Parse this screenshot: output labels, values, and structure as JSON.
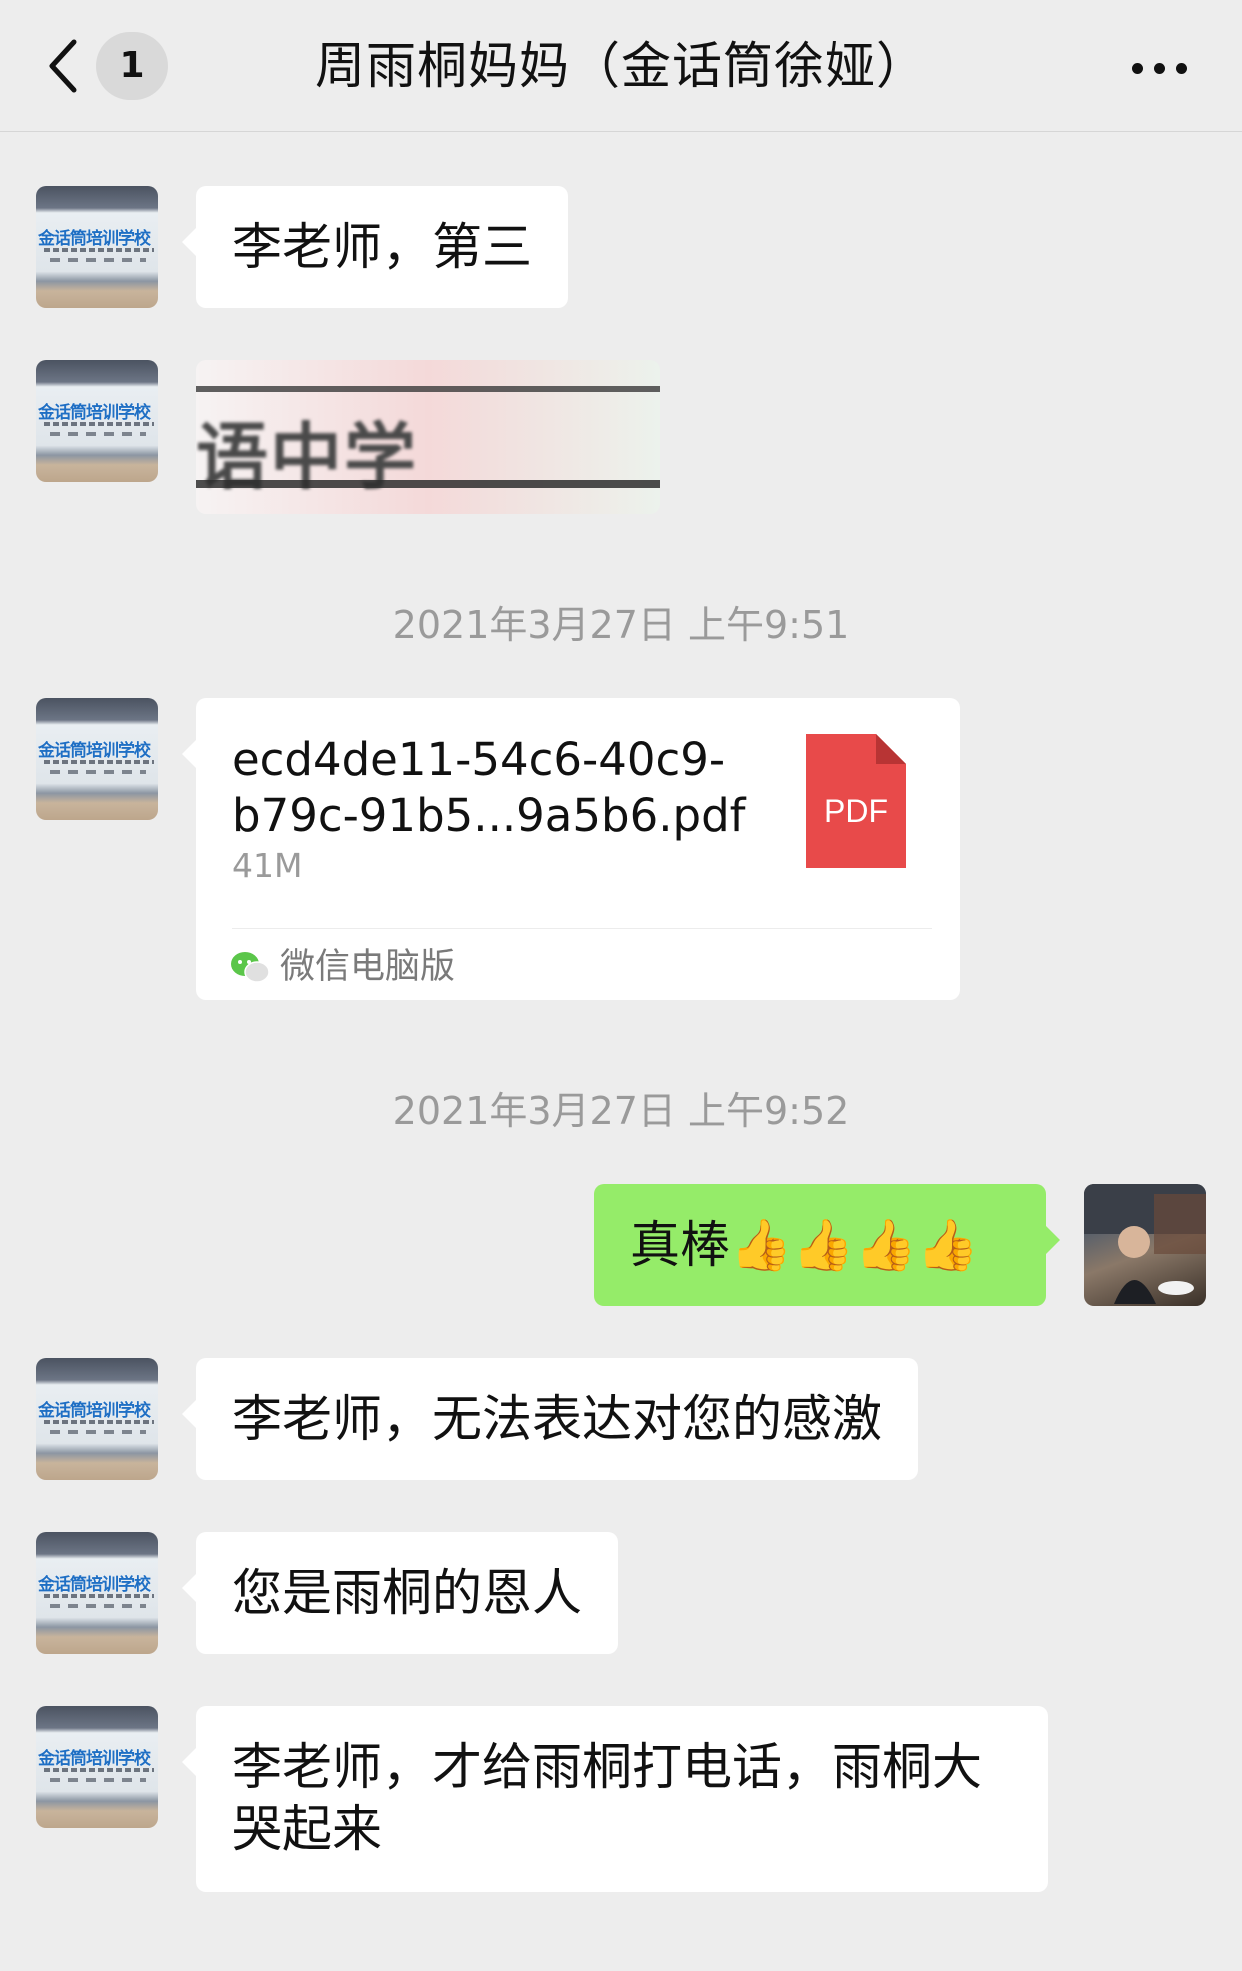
{
  "header": {
    "unread_count": "1",
    "title": "周雨桐妈妈（金话筒徐娅）"
  },
  "avatars": {
    "school_logo_text": "金话筒培训学校"
  },
  "messages": [
    {
      "type": "text",
      "side": "left",
      "text": "李老师，第三"
    },
    {
      "type": "image",
      "side": "left",
      "image_text": "语中学"
    },
    {
      "type": "timestamp",
      "text": "2021年3月27日 上午9:51"
    },
    {
      "type": "file",
      "side": "left",
      "file_name": "ecd4de11-54c6-40c9-b79c-91b5...9a5b6.pdf",
      "file_size": "41M",
      "file_type": "PDF",
      "source": "微信电脑版"
    },
    {
      "type": "timestamp",
      "text": "2021年3月27日 上午9:52"
    },
    {
      "type": "text",
      "side": "right",
      "text": "真棒👍👍👍👍"
    },
    {
      "type": "text",
      "side": "left",
      "text": "李老师，无法表达对您的感激"
    },
    {
      "type": "text",
      "side": "left",
      "text": "您是雨桐的恩人"
    },
    {
      "type": "text",
      "side": "left",
      "text": "李老师，才给雨桐打电话，雨桐大哭起来"
    }
  ],
  "colors": {
    "background": "#ededed",
    "bubble_received": "#ffffff",
    "bubble_sent": "#95ec69",
    "pdf_red": "#e84a4a",
    "timestamp_text": "#9a9a9a"
  },
  "icons": [
    "back-chevron-icon",
    "more-dots-icon",
    "pdf-file-icon",
    "wechat-icon"
  ]
}
